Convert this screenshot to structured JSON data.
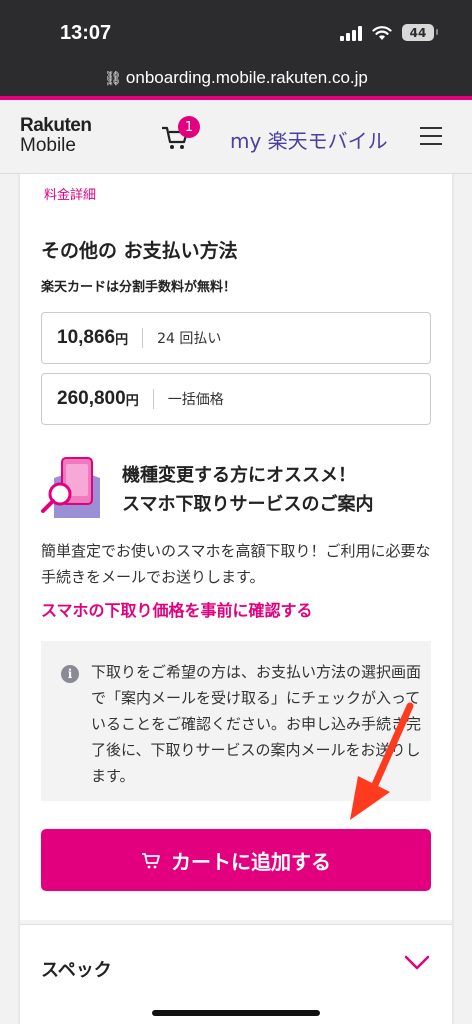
{
  "status_bar": {
    "time": "13:07",
    "battery": "44"
  },
  "browser": {
    "url": "onboarding.mobile.rakuten.co.jp"
  },
  "header": {
    "logo_line1": "Rakuten",
    "logo_line2": "Mobile",
    "cart_count": "1",
    "my_link": "my 楽天モバイル"
  },
  "payment": {
    "detail_link": "料金詳細",
    "title": "その他の お支払い方法",
    "subtitle": "楽天カードは分割手数料が無料！",
    "options": [
      {
        "amount": "10,866",
        "unit": "円",
        "desc": "24 回払い"
      },
      {
        "amount": "260,800",
        "unit": "円",
        "desc": "一括価格"
      }
    ]
  },
  "tradein": {
    "title_line1": "機種変更する方にオススメ！",
    "title_line2": "スマホ下取りサービスのご案内",
    "description": "簡単査定でお使いのスマホを高額下取り！ご利用に必要な手続きをメールでお送りします。",
    "link": "スマホの下取り価格を事前に確認する",
    "info_icon": "i",
    "info": "下取りをご希望の方は、お支払い方法の選択画面で「案内メールを受け取る」にチェックが入っていることをご確認ください。お申し込み手続き完了後に、下取りサービスの案内メールをお送りします。"
  },
  "cart_button": {
    "label": "カートに追加する"
  },
  "spec": {
    "label": "スペック"
  },
  "colors": {
    "brand_pink": "#e3007f",
    "brand_purple": "#4b3fa0",
    "annotation_red": "#ff3b1f"
  }
}
